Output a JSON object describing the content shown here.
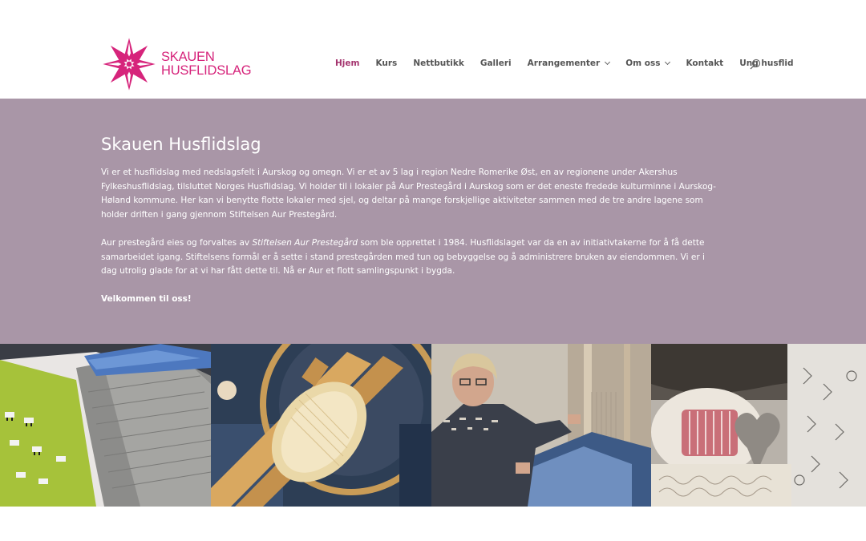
{
  "brand": {
    "line1": "SKAUEN",
    "line2": "HUSFLIDSLAG",
    "color": "#d6247b",
    "logo_icon": "eight-point-star-icon"
  },
  "nav": {
    "items": [
      {
        "label": "Hjem",
        "active": true
      },
      {
        "label": "Kurs"
      },
      {
        "label": "Nettbutikk"
      },
      {
        "label": "Galleri"
      },
      {
        "label": "Arrangementer",
        "dropdown": true
      },
      {
        "label": "Om oss",
        "dropdown": true
      },
      {
        "label": "Kontakt"
      },
      {
        "label": "Ung husflid"
      }
    ],
    "active_color": "#a4346e",
    "search_icon": "search-icon"
  },
  "hero": {
    "title": "Skauen Husflidslag",
    "background": "#a996a7",
    "p1": "Vi er et husflidslag med nedslagsfelt i Aurskog og omegn. Vi er et av 5 lag i region Nedre Romerike Øst, en av regionene under Akershus Fylkeshusflidslag, tilsluttet Norges Husflidslag. Vi holder til i lokaler på Aur Prestegård i Aurskog som er det eneste fredede kulturminne i Aurskog-Høland kommune. Her kan vi benytte flotte lokaler med sjel, og deltar på mange forskjellige aktiviteter sammen med de tre andre lagene som holder driften i gang gjennom Stiftelsen Aur Prestegård.",
    "p2_before": "Aur prestegård eies og forvaltes av ",
    "p2_em": "Stiftelsen Aur Prestegård",
    "p2_after": " som ble opprettet i 1984. Husflidslaget var da en av initiativtakerne for å få dette samarbeidet igang. Stiftelsens formål er å sette i stand prestegården med tun og bebyggelse og å administrere bruken av eiendommen. Vi er i dag utrolig glade for at vi har fått dette til. Nå er Aur et flott samlingspunkt i bygda.",
    "p3": "Velkommen til oss!"
  },
  "gallery": {
    "tiles": [
      "knitted-textiles-image",
      "spinning-wheel-image",
      "weaver-at-loom-image",
      "sheepskin-cushions-image"
    ]
  }
}
